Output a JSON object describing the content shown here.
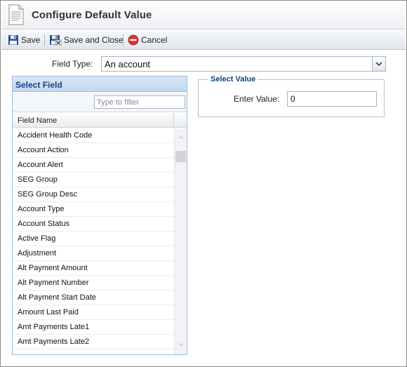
{
  "window": {
    "title": "Configure Default Value"
  },
  "toolbar": {
    "save_label": "Save",
    "save_close_label": "Save and Close",
    "cancel_label": "Cancel"
  },
  "field_type": {
    "label": "Field Type:",
    "value": "An account"
  },
  "select_field": {
    "title": "Select Field",
    "filter_placeholder": "Type to filter",
    "column_header": "Field Name",
    "rows": [
      "Accident Health Code",
      "Account Action",
      "Account Alert",
      "SEG Group",
      "SEG Group Desc",
      "Account Type",
      "Account Status",
      "Active Flag",
      "Adjustment",
      "Alt Payment Amount",
      "Alt Payment Number",
      "Alt Payment Start Date",
      "Amount Last Paid",
      "Amt Payments Late1",
      "Amt Payments Late2"
    ]
  },
  "select_value": {
    "legend": "Select Value",
    "label": "Enter Value:",
    "value": "0"
  },
  "colors": {
    "panel_title": "#15428b",
    "panel_border": "#99bbe8",
    "cancel_icon": "#d9342b",
    "save_icon": "#2b4f8f"
  },
  "icons": {
    "title": "document-icon",
    "save": "floppy-disk-icon",
    "save_close": "floppy-disk-close-icon",
    "cancel": "cancel-circle-icon",
    "dropdown": "chevron-down-icon"
  }
}
